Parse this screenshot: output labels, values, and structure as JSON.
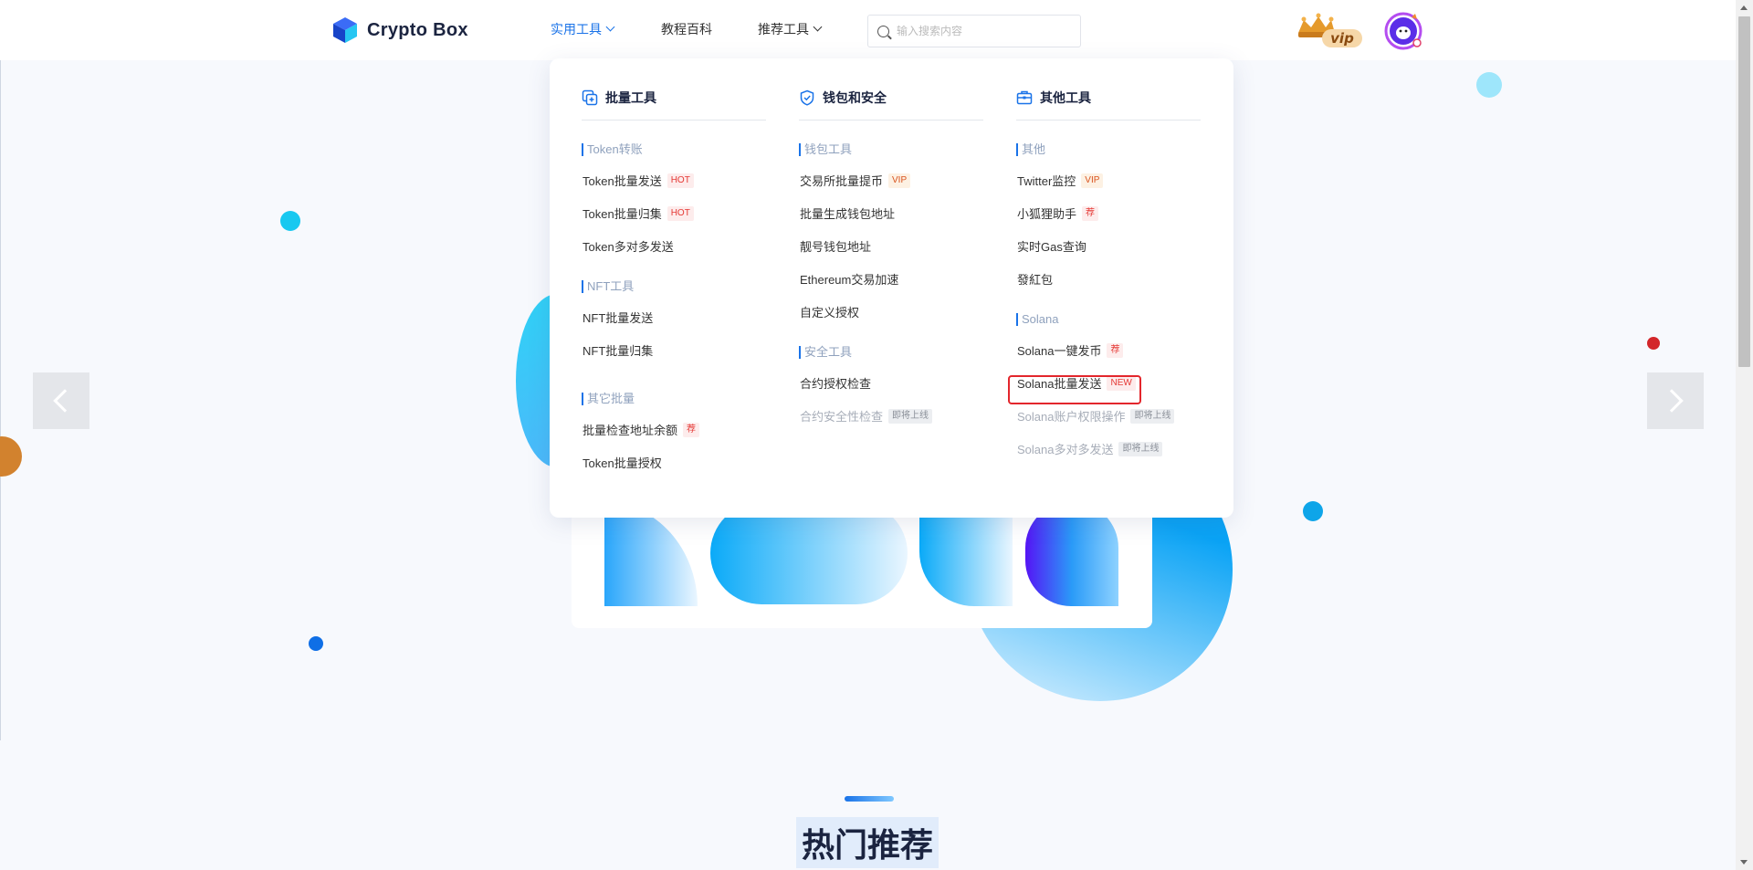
{
  "header": {
    "logo_text": "Crypto Box",
    "nav": [
      {
        "label": "实用工具",
        "active": true,
        "dropdown": true
      },
      {
        "label": "教程百科",
        "active": false,
        "dropdown": false
      },
      {
        "label": "推荐工具",
        "active": false,
        "dropdown": true
      }
    ],
    "search_placeholder": "输入搜索内容",
    "vip_label": "vip"
  },
  "menu": {
    "columns": [
      {
        "title": "批量工具",
        "icon": "batch-copy-icon",
        "groups": [
          {
            "label": "Token转账",
            "items": [
              {
                "label": "Token批量发送",
                "badge": "HOT",
                "badge_type": "hot"
              },
              {
                "label": "Token批量归集",
                "badge": "HOT",
                "badge_type": "hot"
              },
              {
                "label": "Token多对多发送",
                "badge": "",
                "badge_type": ""
              }
            ]
          },
          {
            "label": "NFT工具",
            "items": [
              {
                "label": "NFT批量发送",
                "badge": "",
                "badge_type": ""
              },
              {
                "label": "NFT批量归集",
                "badge": "",
                "badge_type": ""
              }
            ]
          },
          {
            "label": "其它批量",
            "items": [
              {
                "label": "批量检查地址余额",
                "badge": "荐",
                "badge_type": "rec"
              },
              {
                "label": "Token批量授权",
                "badge": "",
                "badge_type": ""
              }
            ]
          }
        ]
      },
      {
        "title": "钱包和安全",
        "icon": "shield-check-icon",
        "groups": [
          {
            "label": "钱包工具",
            "items": [
              {
                "label": "交易所批量提币",
                "badge": "VIP",
                "badge_type": "vip"
              },
              {
                "label": "批量生成钱包地址",
                "badge": "",
                "badge_type": ""
              },
              {
                "label": "靓号钱包地址",
                "badge": "",
                "badge_type": ""
              },
              {
                "label": "Ethereum交易加速",
                "badge": "",
                "badge_type": ""
              },
              {
                "label": "自定义授权",
                "badge": "",
                "badge_type": ""
              }
            ]
          },
          {
            "label": "安全工具",
            "items": [
              {
                "label": "合约授权检查",
                "badge": "",
                "badge_type": ""
              },
              {
                "label": "合约安全性检查",
                "badge": "即将上线",
                "badge_type": "soon",
                "disabled": true
              }
            ]
          }
        ]
      },
      {
        "title": "其他工具",
        "icon": "toolbox-icon",
        "groups": [
          {
            "label": "其他",
            "items": [
              {
                "label": "Twitter监控",
                "badge": "VIP",
                "badge_type": "vip"
              },
              {
                "label": "小狐狸助手",
                "badge": "荐",
                "badge_type": "rec"
              },
              {
                "label": "实时Gas查询",
                "badge": "",
                "badge_type": ""
              },
              {
                "label": "發紅包",
                "badge": "",
                "badge_type": ""
              }
            ]
          },
          {
            "label": "Solana",
            "items": [
              {
                "label": "Solana一键发币",
                "badge": "荐",
                "badge_type": "rec"
              },
              {
                "label": "Solana批量发送",
                "badge": "NEW",
                "badge_type": "new"
              },
              {
                "label": "Solana账户权限操作",
                "badge": "即将上线",
                "badge_type": "soon",
                "disabled": true
              },
              {
                "label": "Solana多对多发送",
                "badge": "即将上线",
                "badge_type": "soon",
                "disabled": true
              }
            ]
          }
        ]
      }
    ]
  },
  "section": {
    "title": "热门推荐"
  },
  "colors": {
    "accent": "#1a73e8",
    "hot": "#e53935",
    "highlight": "#e3262c"
  }
}
